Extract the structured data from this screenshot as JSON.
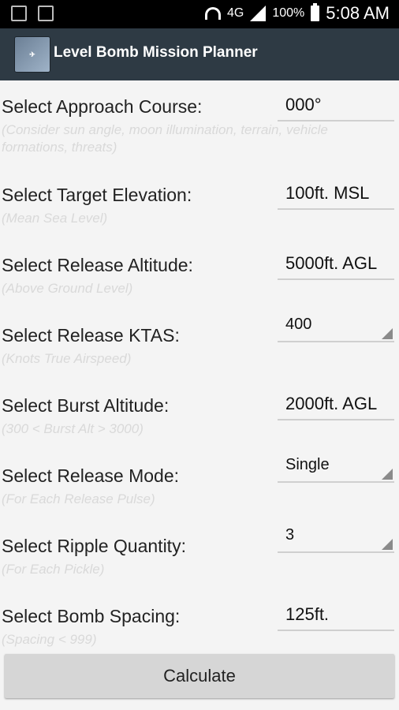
{
  "status_bar": {
    "battery": "100%",
    "network": "4G",
    "time": "5:08 AM"
  },
  "app_bar": {
    "title": "Level Bomb Mission Planner"
  },
  "form": {
    "approach_course": {
      "label": "Select Approach Course:",
      "hint": "(Consider sun angle, moon illumination, terrain, vehicle formations, threats)",
      "value": "000°"
    },
    "target_elevation": {
      "label": "Select Target Elevation:",
      "hint": "(Mean Sea Level)",
      "value": "100ft. MSL"
    },
    "release_altitude": {
      "label": "Select Release Altitude:",
      "hint": "(Above Ground Level)",
      "value": "5000ft. AGL"
    },
    "release_ktas": {
      "label": "Select Release KTAS:",
      "hint": "(Knots True Airspeed)",
      "value": "400"
    },
    "burst_altitude": {
      "label": "Select Burst Altitude:",
      "hint": "(300 < Burst Alt > 3000)",
      "value": "2000ft. AGL"
    },
    "release_mode": {
      "label": "Select Release Mode:",
      "hint": "(For Each Release Pulse)",
      "value": "Single"
    },
    "ripple_quantity": {
      "label": "Select Ripple Quantity:",
      "hint": "(For Each Pickle)",
      "value": "3"
    },
    "bomb_spacing": {
      "label": "Select Bomb Spacing:",
      "hint": "(Spacing < 999)",
      "value": "125ft."
    }
  },
  "calculate_button": "Calculate"
}
